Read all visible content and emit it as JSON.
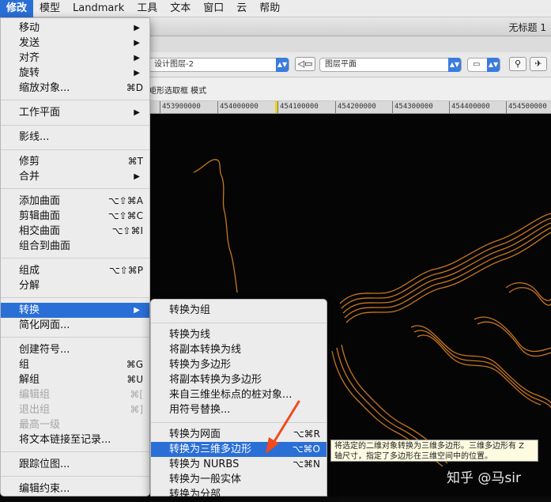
{
  "menubar": {
    "items": [
      "修改",
      "模型",
      "Landmark",
      "工具",
      "文本",
      "窗口",
      "云",
      "帮助"
    ]
  },
  "window": {
    "title": "无标题 1"
  },
  "toolbar": {
    "layer_combo": "设计图层-2",
    "view_combo": "图层平面"
  },
  "modebar": {
    "label": "矩形选取框 模式"
  },
  "ruler": {
    "ticks": [
      "453900000",
      "454000000",
      "454100000",
      "454200000",
      "454300000",
      "454400000",
      "454500000"
    ]
  },
  "modify_menu": {
    "items": [
      {
        "label": "移动",
        "shortcut": "",
        "submenu": true
      },
      {
        "label": "发送",
        "shortcut": "",
        "submenu": true
      },
      {
        "label": "对齐",
        "shortcut": "",
        "submenu": true
      },
      {
        "label": "旋转",
        "shortcut": "",
        "submenu": true
      },
      {
        "label": "缩放对象...",
        "shortcut": "⌘D",
        "submenu": false
      },
      {
        "label": "工作平面",
        "shortcut": "",
        "submenu": true
      },
      {
        "label": "影线...",
        "shortcut": "",
        "submenu": false
      },
      {
        "label": "修剪",
        "shortcut": "⌘T",
        "submenu": false
      },
      {
        "label": "合并",
        "shortcut": "",
        "submenu": true
      },
      {
        "label": "添加曲面",
        "shortcut": "⌥⇧⌘A",
        "submenu": false
      },
      {
        "label": "剪辑曲面",
        "shortcut": "⌥⇧⌘C",
        "submenu": false
      },
      {
        "label": "相交曲面",
        "shortcut": "⌥⇧⌘I",
        "submenu": false
      },
      {
        "label": "组合到曲面",
        "shortcut": "",
        "submenu": false
      },
      {
        "label": "组成",
        "shortcut": "⌥⇧⌘P",
        "submenu": false
      },
      {
        "label": "分解",
        "shortcut": "",
        "submenu": false
      },
      {
        "label": "转换",
        "shortcut": "",
        "submenu": true
      },
      {
        "label": "简化网面...",
        "shortcut": "",
        "submenu": false
      },
      {
        "label": "创建符号...",
        "shortcut": "",
        "submenu": false
      },
      {
        "label": "组",
        "shortcut": "⌘G",
        "submenu": false
      },
      {
        "label": "解组",
        "shortcut": "⌘U",
        "submenu": false
      },
      {
        "label": "编辑组",
        "shortcut": "⌘[",
        "submenu": false
      },
      {
        "label": "退出组",
        "shortcut": "⌘]",
        "submenu": false
      },
      {
        "label": "最高一级",
        "shortcut": "",
        "submenu": false
      },
      {
        "label": "将文本链接至记录...",
        "shortcut": "",
        "submenu": false
      },
      {
        "label": "跟踪位图...",
        "shortcut": "",
        "submenu": false
      },
      {
        "label": "编辑约束...",
        "shortcut": "",
        "submenu": false
      }
    ]
  },
  "convert_submenu": {
    "items": [
      {
        "label": "转换为组",
        "shortcut": ""
      },
      {
        "label": "转换为线",
        "shortcut": ""
      },
      {
        "label": "将副本转换为线",
        "shortcut": ""
      },
      {
        "label": "转换为多边形",
        "shortcut": ""
      },
      {
        "label": "将副本转换为多边形",
        "shortcut": ""
      },
      {
        "label": "来自三维坐标点的桩对象...",
        "shortcut": ""
      },
      {
        "label": "用符号替换...",
        "shortcut": ""
      },
      {
        "label": "转换为网面",
        "shortcut": "⌥⌘R"
      },
      {
        "label": "转换为三维多边形",
        "shortcut": "⌥⌘O"
      },
      {
        "label": "转换为 NURBS",
        "shortcut": "⌥⌘N"
      },
      {
        "label": "转换为一般实体",
        "shortcut": ""
      },
      {
        "label": "转换为分部",
        "shortcut": ""
      }
    ]
  },
  "tooltip": {
    "text": "将选定的二维对象转换为三维多边形。三维多边形有 Z 轴尺寸，指定了多边形在三维空间中的位置。"
  },
  "watermark": {
    "text": "知乎 @马sir"
  },
  "colors": {
    "accent": "#2a6fd6",
    "contour": "#c8761e",
    "arrow": "#f04a1e"
  }
}
